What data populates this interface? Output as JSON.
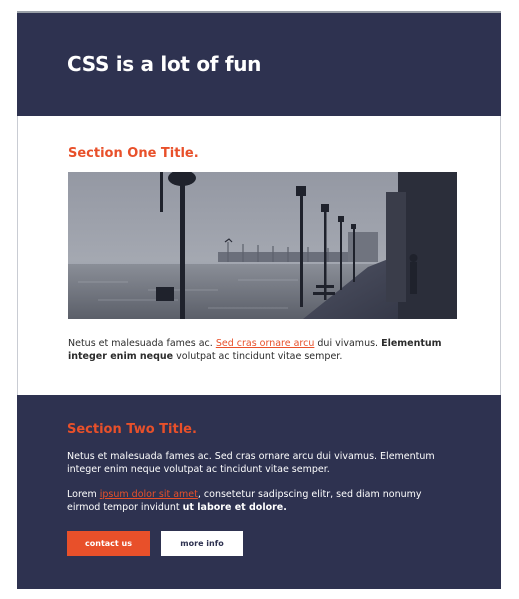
{
  "header": {
    "title": "CSS is a lot of fun"
  },
  "section_one": {
    "title": "Section One Title.",
    "photo_icon": "foggy-pier-photo",
    "paragraph": {
      "text_a": "Netus et malesuada fames ac. ",
      "link": "Sed cras ornare arcu",
      "text_b": " dui vivamus. ",
      "bold": "Elementum integer enim neque",
      "text_c": " volutpat ac tincidunt vitae semper."
    }
  },
  "section_two": {
    "title": "Section Two Title.",
    "paragraph1": "Netus et malesuada fames ac. Sed cras ornare arcu dui vivamus. Elementum integer enim neque volutpat ac tincidunt vitae semper.",
    "paragraph2": {
      "text_a": "Lorem ",
      "link": "ipsum dolor sit amet",
      "text_b": ", consetetur sadipscing elitr, sed diam nonumy eirmod tempor invidunt ",
      "bold": "ut labore et dolore."
    },
    "buttons": {
      "contact": "contact us",
      "more": "more info"
    }
  },
  "colors": {
    "navy": "#2e3250",
    "accent": "#e8502a",
    "white": "#ffffff"
  }
}
